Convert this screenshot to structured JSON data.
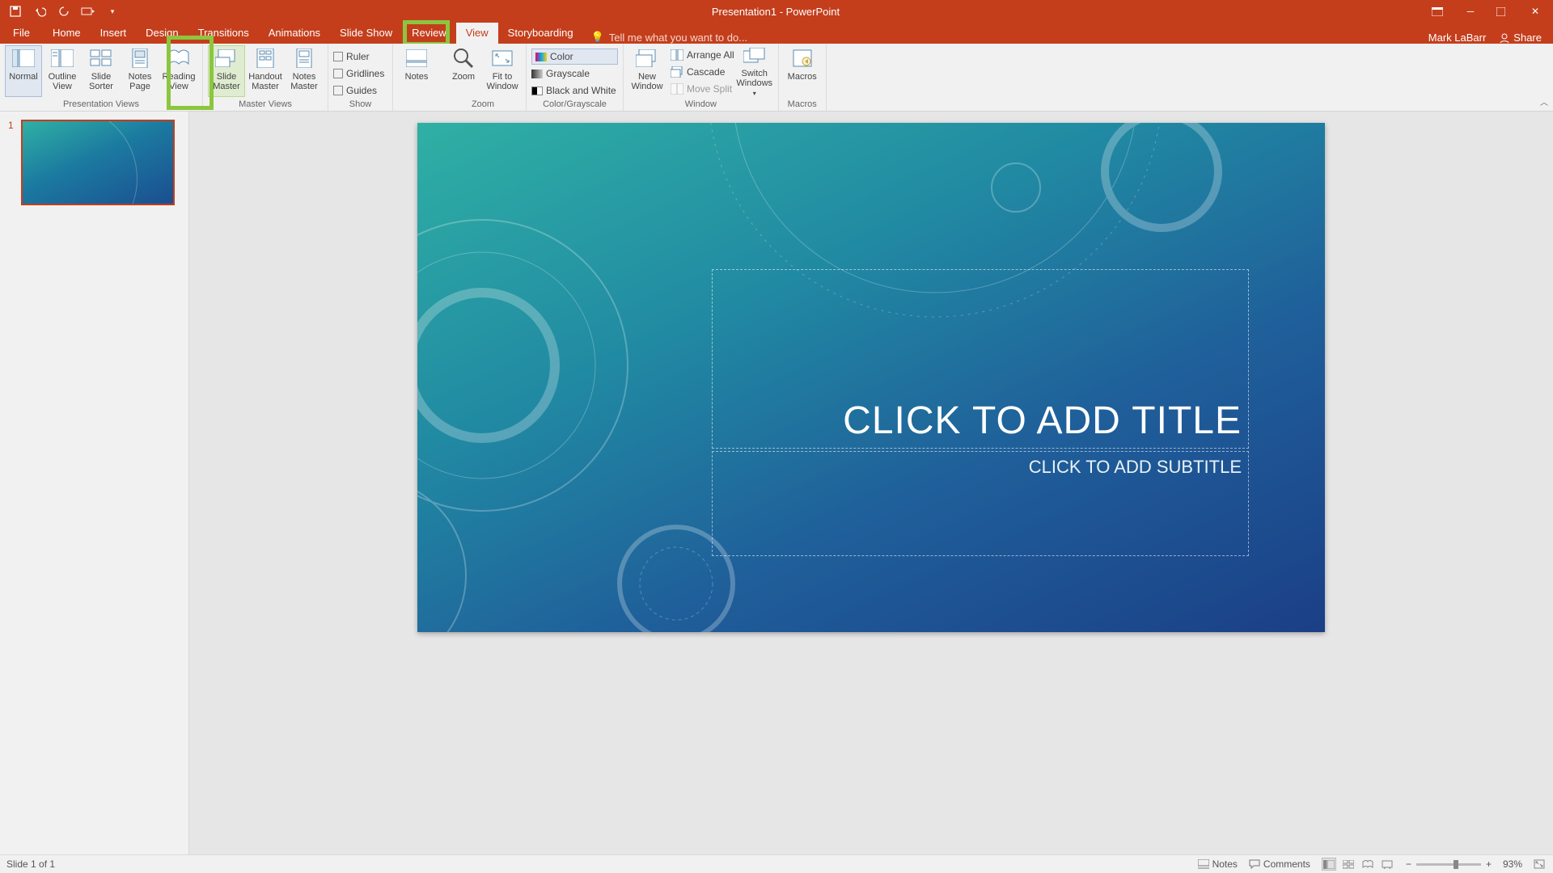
{
  "titlebar": {
    "title": "Presentation1 - PowerPoint"
  },
  "tabs": {
    "file": "File",
    "items": [
      "Home",
      "Insert",
      "Design",
      "Transitions",
      "Animations",
      "Slide Show",
      "Review",
      "View",
      "Storyboarding"
    ],
    "active": "View",
    "tellme_placeholder": "Tell me what you want to do...",
    "user": "Mark LaBarr",
    "share": "Share"
  },
  "ribbon": {
    "presentation_views": {
      "label": "Presentation Views",
      "normal": "Normal",
      "outline": "Outline View",
      "sorter": "Slide Sorter",
      "notespage": "Notes Page",
      "reading": "Reading View"
    },
    "master_views": {
      "label": "Master Views",
      "slide": "Slide Master",
      "handout": "Handout Master",
      "notes": "Notes Master"
    },
    "show": {
      "label": "Show",
      "ruler": "Ruler",
      "gridlines": "Gridlines",
      "guides": "Guides"
    },
    "notes": {
      "label": "Notes"
    },
    "zoom": {
      "label": "Zoom",
      "zoom": "Zoom",
      "fit": "Fit to Window"
    },
    "colorgray": {
      "label": "Color/Grayscale",
      "color": "Color",
      "gray": "Grayscale",
      "bw": "Black and White"
    },
    "window": {
      "label": "Window",
      "neww": "New Window",
      "arrange": "Arrange All",
      "cascade": "Cascade",
      "movesplit": "Move Split",
      "switch": "Switch Windows"
    },
    "macros": {
      "label": "Macros",
      "macros": "Macros"
    }
  },
  "thumbs": {
    "n1": "1"
  },
  "slide": {
    "title_placeholder": "CLICK TO ADD TITLE",
    "subtitle_placeholder": "CLICK TO ADD SUBTITLE"
  },
  "statusbar": {
    "slide_of": "Slide 1 of 1",
    "notes": "Notes",
    "comments": "Comments",
    "zoom_pct": "93%"
  }
}
